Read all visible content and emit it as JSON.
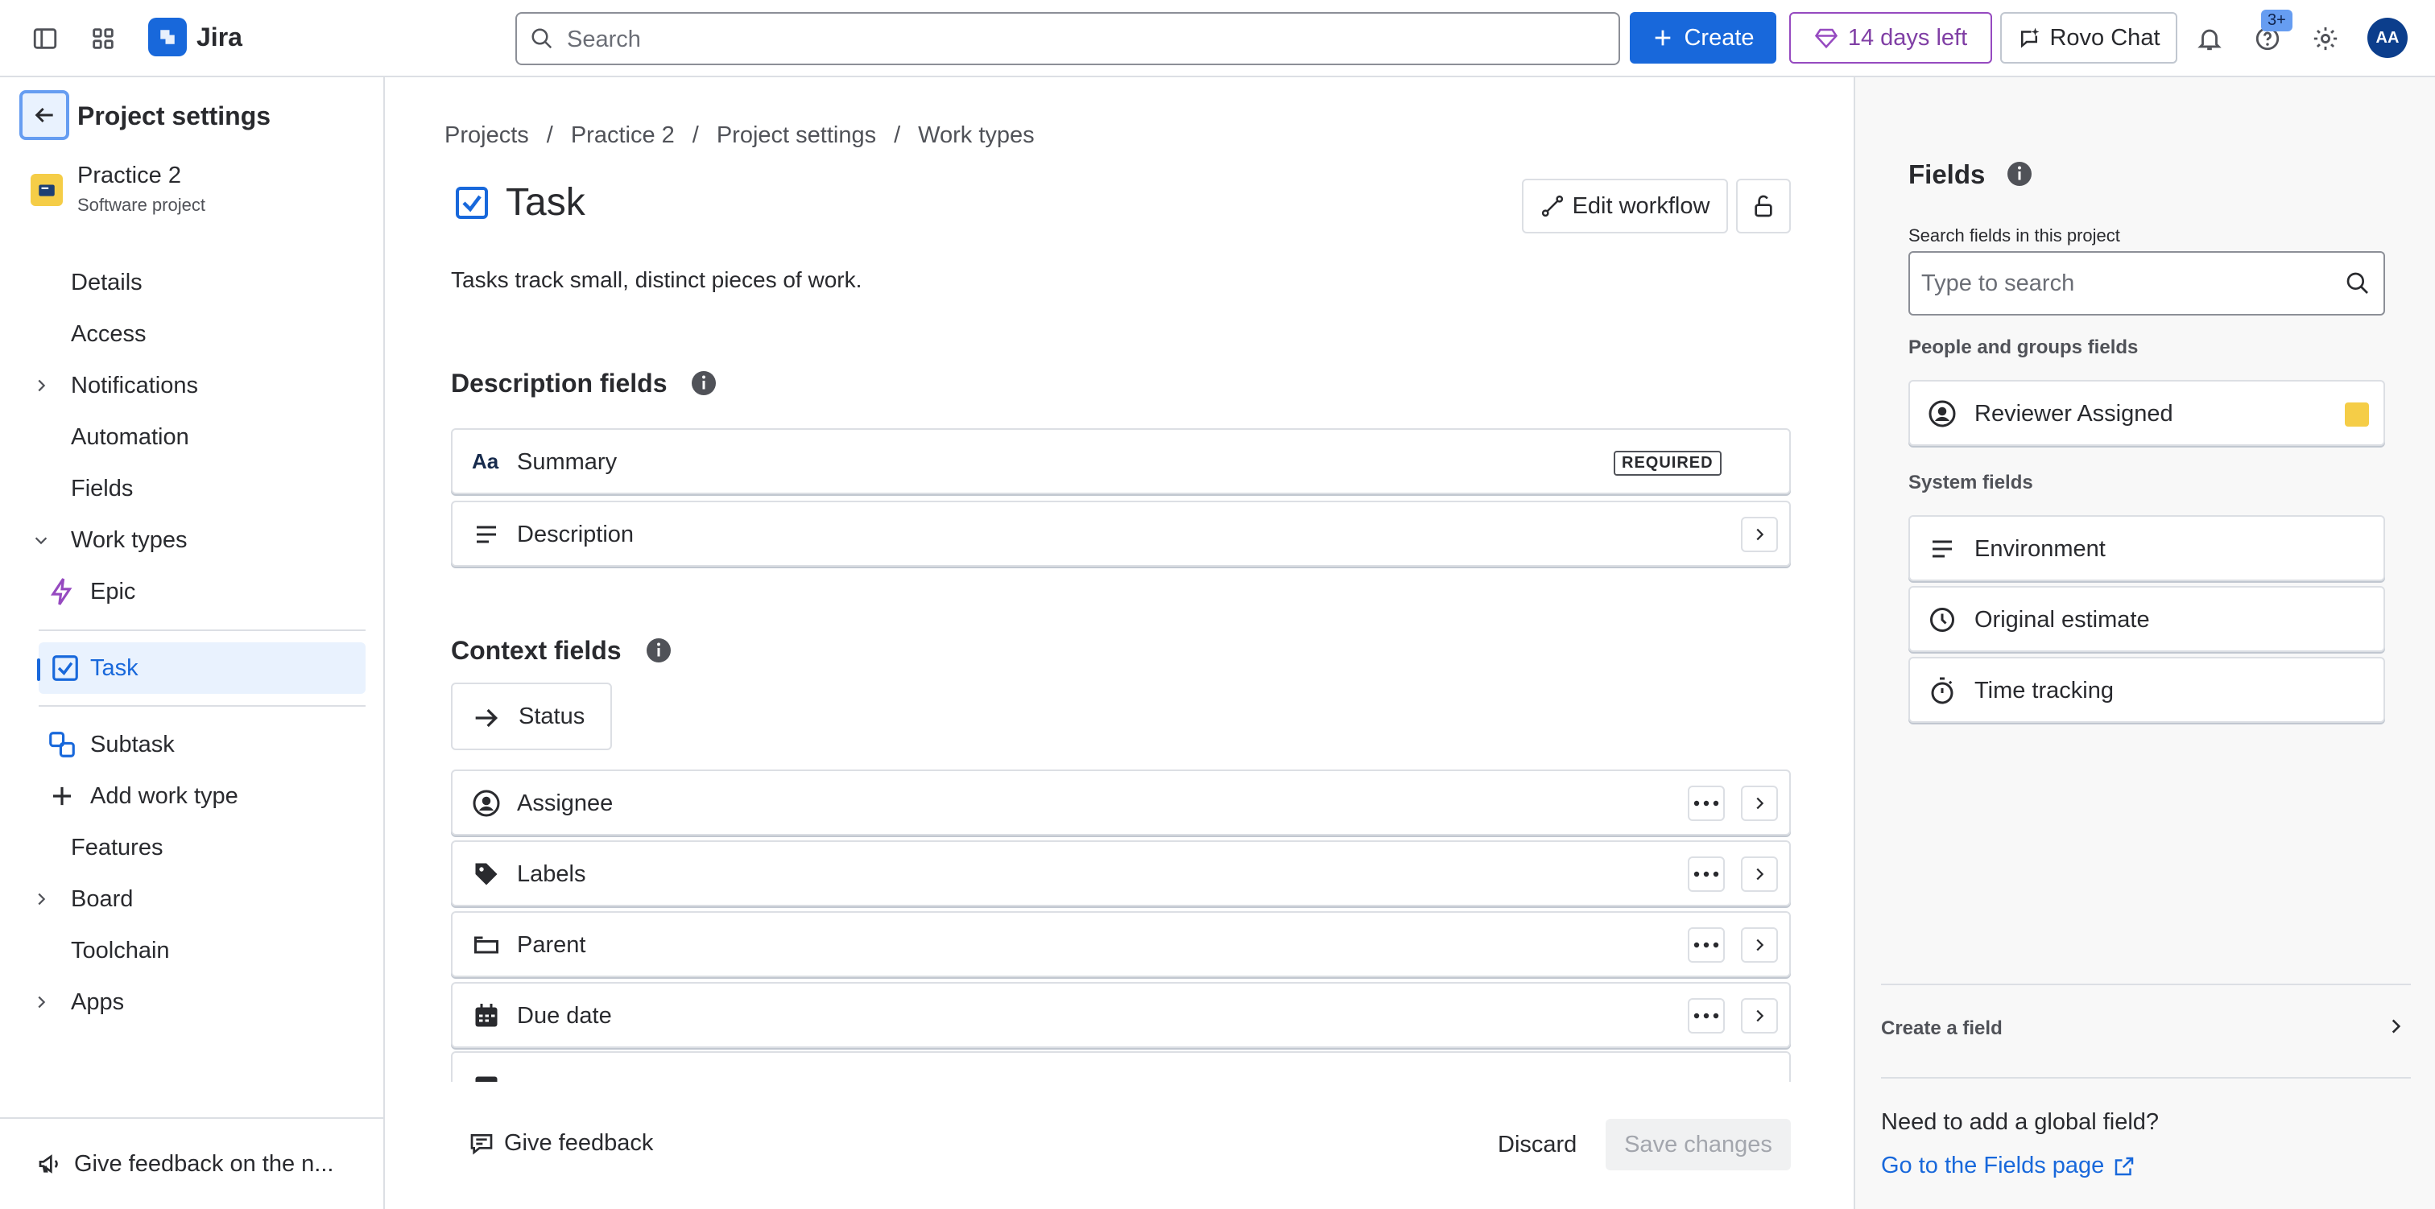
{
  "topbar": {
    "app_name": "Jira",
    "search_placeholder": "Search",
    "create_label": "Create",
    "trial_label": "14 days left",
    "rovo_label": "Rovo Chat",
    "help_badge": "3+",
    "avatar_initials": "AA",
    "accent_color": "#1868db",
    "trial_color": "#803fa5"
  },
  "sidebar": {
    "title": "Project settings",
    "project_name": "Practice 2",
    "project_type": "Software project",
    "items": [
      {
        "label": "Details"
      },
      {
        "label": "Access"
      },
      {
        "label": "Notifications",
        "expandable": true
      },
      {
        "label": "Automation"
      },
      {
        "label": "Fields"
      },
      {
        "label": "Work types",
        "expanded": true
      },
      {
        "label": "Epic",
        "icon": "epic-icon"
      },
      {
        "label": "Task",
        "icon": "task-icon",
        "selected": true
      },
      {
        "label": "Subtask",
        "icon": "subtask-icon"
      },
      {
        "label": "Add work type",
        "icon": "plus-icon"
      },
      {
        "label": "Features"
      },
      {
        "label": "Board",
        "expandable": true
      },
      {
        "label": "Toolchain"
      },
      {
        "label": "Apps",
        "expandable": true
      }
    ],
    "feedback_label": "Give feedback on the n..."
  },
  "main": {
    "breadcrumbs": [
      "Projects",
      "Practice 2",
      "Project settings",
      "Work types"
    ],
    "title": "Task",
    "edit_workflow_label": "Edit workflow",
    "description": "Tasks track small, distinct pieces of work.",
    "description_fields_heading": "Description fields",
    "description_fields": [
      {
        "label": "Summary",
        "badge": "REQUIRED",
        "icon": "text-format-icon"
      },
      {
        "label": "Description",
        "icon": "text-lines-icon"
      }
    ],
    "context_fields_heading": "Context fields",
    "status_label": "Status",
    "context_fields": [
      {
        "label": "Assignee",
        "icon": "person-icon"
      },
      {
        "label": "Labels",
        "icon": "tag-icon"
      },
      {
        "label": "Parent",
        "icon": "parent-icon"
      },
      {
        "label": "Due date",
        "icon": "calendar-icon"
      }
    ],
    "give_feedback_label": "Give feedback",
    "discard_label": "Discard",
    "save_label": "Save changes"
  },
  "right_panel": {
    "title": "Fields",
    "search_label": "Search fields in this project",
    "search_placeholder": "Type to search",
    "people_heading": "People and groups fields",
    "people_fields": [
      {
        "label": "Reviewer Assigned",
        "icon": "person-icon"
      }
    ],
    "system_heading": "System fields",
    "system_fields": [
      {
        "label": "Environment",
        "icon": "text-lines-icon"
      },
      {
        "label": "Original estimate",
        "icon": "clock-icon"
      },
      {
        "label": "Time tracking",
        "icon": "stopwatch-icon"
      }
    ],
    "create_field_label": "Create a field",
    "need_global_text": "Need to add a global field?",
    "go_fields_link": "Go to the Fields page"
  }
}
